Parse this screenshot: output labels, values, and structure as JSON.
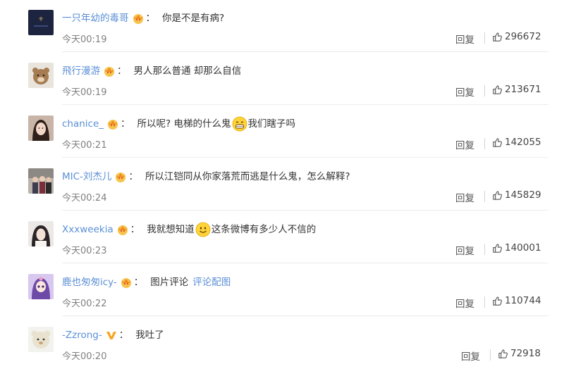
{
  "colors": {
    "username": "#5b8fd6",
    "text": "#333333",
    "meta": "#808080"
  },
  "comments": [
    {
      "username": "一只年幼的毒哥",
      "badge": "crown-badge-icon",
      "separator": "：",
      "text": "你是不是有病?",
      "text2": "",
      "link": "",
      "emoji": "",
      "timestamp": "今天00:19",
      "reply_label": "回复",
      "likes": "296672"
    },
    {
      "username": "飛行漫游",
      "badge": "crown-badge-icon",
      "separator": "：",
      "text": "男人那么普通 却那么自信",
      "text2": "",
      "link": "",
      "emoji": "",
      "timestamp": "今天00:19",
      "reply_label": "回复",
      "likes": "213671"
    },
    {
      "username": "chanice_",
      "badge": "crown-badge-icon",
      "separator": "：",
      "text": "所以呢? 电梯的什么鬼",
      "text2": "我们瞎子吗",
      "link": "",
      "emoji": "grin-emoji-icon",
      "timestamp": "今天00:21",
      "reply_label": "回复",
      "likes": "142055"
    },
    {
      "username": "MIC-刘杰儿",
      "badge": "crown-badge-icon",
      "separator": "：",
      "text": "所以江铠同从你家落荒而逃是什么鬼，怎么解释?",
      "text2": "",
      "link": "",
      "emoji": "",
      "timestamp": "今天00:24",
      "reply_label": "回复",
      "likes": "145829"
    },
    {
      "username": "Xxxweekia",
      "badge": "crown-badge-icon",
      "separator": "：",
      "text": "我就想知道",
      "text2": "这条微博有多少人不信的",
      "link": "",
      "emoji": "smile-emoji-icon",
      "timestamp": "今天00:23",
      "reply_label": "回复",
      "likes": "140001"
    },
    {
      "username": "鹿也匆匆icy-",
      "badge": "crown-badge-icon",
      "separator": "：",
      "text": "图片评论",
      "text2": "",
      "link": "评论配图",
      "emoji": "",
      "timestamp": "今天00:22",
      "reply_label": "回复",
      "likes": "110744"
    },
    {
      "username": "-Zzrong-",
      "badge": "verified-v-badge-icon",
      "separator": "：",
      "text": "我吐了",
      "text2": "",
      "link": "",
      "emoji": "",
      "timestamp": "今天00:20",
      "reply_label": "回复",
      "likes": "72918"
    }
  ]
}
